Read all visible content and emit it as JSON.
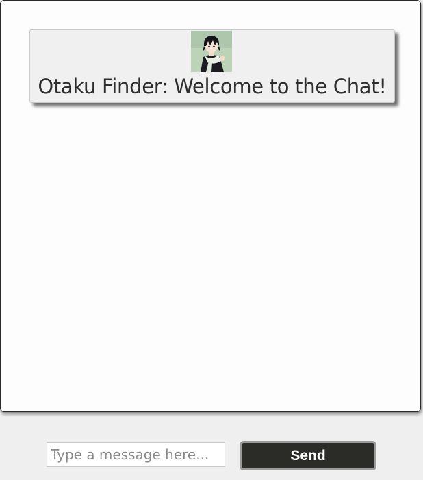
{
  "chat": {
    "welcome_message": "Otaku Finder: Welcome to the Chat!",
    "avatar_icon": "anime-character-avatar",
    "messages": []
  },
  "composer": {
    "placeholder": "Type a message here...",
    "value": "",
    "send_label": "Send"
  },
  "colors": {
    "page_background": "#efefef",
    "chat_background": "#fdfdfd",
    "card_background": "#f0f0f0",
    "send_button": "#2b2b28",
    "send_text": "#ffffff"
  }
}
